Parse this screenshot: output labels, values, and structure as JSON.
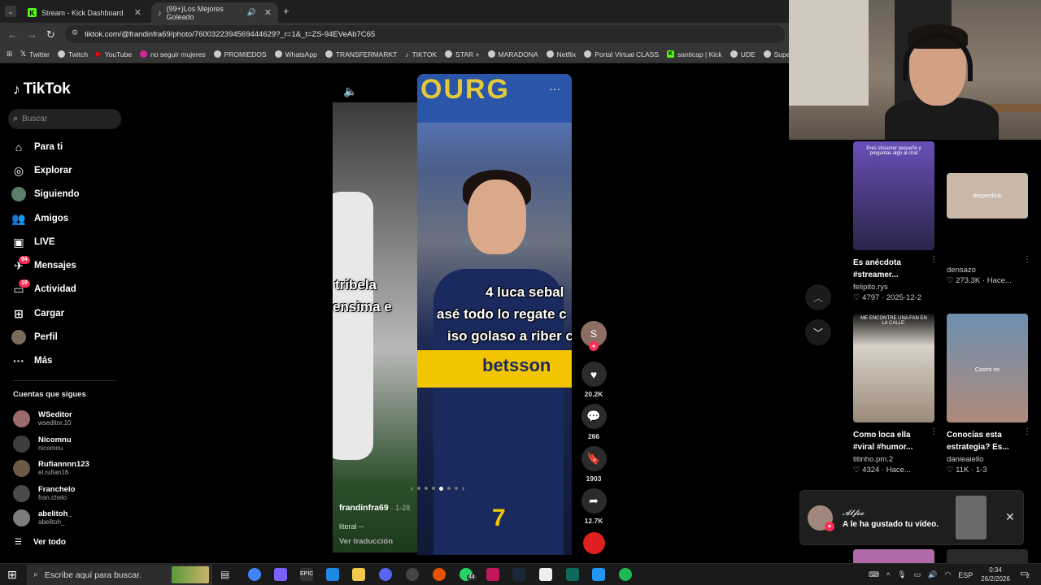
{
  "browser": {
    "tabs": [
      {
        "label": "Stream - Kick Dashboard",
        "active": false
      },
      {
        "label": "(99+)Los Mejores Goleado",
        "active": true
      }
    ],
    "new_tab": "+",
    "url": "tiktok.com/@frandinfra69/photo/7600322394569444629?_r=1&_t=ZS-94EVeAb7C65",
    "bookmarks": [
      "Twitter",
      "Twitch",
      "YouTube",
      "no seguir mujeres",
      "PROMIEDOS",
      "WhatsApp",
      "TRANSFERMARKT",
      "TIKTOK",
      "STAR +",
      "MARADONA",
      "Netflix",
      "Portal Virtual CLASS",
      "santicap | Kick",
      "UDE",
      "Super"
    ]
  },
  "tiktok": {
    "logo": "TikTok",
    "search_placeholder": "Buscar",
    "nav": [
      {
        "label": "Para ti",
        "icon": "home-icon"
      },
      {
        "label": "Explorar",
        "icon": "compass-icon"
      },
      {
        "label": "Siguiendo",
        "icon": "following-avatar-icon"
      },
      {
        "label": "Amigos",
        "icon": "friends-icon"
      },
      {
        "label": "LIVE",
        "icon": "live-icon"
      },
      {
        "label": "Mensajes",
        "icon": "messages-icon",
        "badge": "94"
      },
      {
        "label": "Actividad",
        "icon": "activity-icon",
        "badge": "19"
      },
      {
        "label": "Cargar",
        "icon": "upload-icon"
      },
      {
        "label": "Perfil",
        "icon": "profile-icon"
      },
      {
        "label": "Más",
        "icon": "more-icon"
      }
    ],
    "following_title": "Cuentas que sigues",
    "following": [
      {
        "name": "WSeditor",
        "handle": "wseditor.10"
      },
      {
        "name": "Nicomnu",
        "handle": "nicomnu"
      },
      {
        "name": "Rufiannnn123",
        "handle": "el.rufian16"
      },
      {
        "name": "Franchelo",
        "handle": "fran.chelo"
      },
      {
        "name": "abelitoh_",
        "handle": "abelitoh_"
      }
    ],
    "see_all": "Ver todo"
  },
  "post": {
    "left_caption_1": "tribela",
    "left_caption_2": "ensima e",
    "caption_1": "4 luca sebal",
    "caption_2": "asé todo lo regate c",
    "caption_3": "iso golaso a riber c",
    "sponsor": "betsson",
    "banner": "OURG",
    "shirt_number": "7",
    "username": "frandinfra69",
    "date": "· 1-28",
    "description": "literal --",
    "translate": "Ver traducción",
    "creator_initial": "S",
    "likes": "20.2K",
    "comments": "266",
    "saves": "1903",
    "shares": "12.7K",
    "slide_index": 4,
    "slide_count": 6
  },
  "grid": [
    {
      "overlay": "Eres streamer pequeño y preguntas algo al chat",
      "title_1": "Es anécdota",
      "title_2": "#streamer...",
      "user": "felipito.rys",
      "likes": "4797",
      "meta": "2025-12-2",
      "color": "#7b5cc9"
    },
    {
      "overlay": "desperdicio",
      "title_1": "",
      "title_2": "",
      "user": "densazo",
      "likes": "273.3K",
      "meta": "Hace...",
      "color": "#c9b8a8"
    },
    {
      "overlay": "ME ENCONTRE UNA FAN EN LA CALLE:",
      "title_1": "Como loca ella",
      "title_2": "#viral #humor...",
      "user": "titinho.pm.2",
      "likes": "4324",
      "meta": "Hace...",
      "color": "#d8d2c8"
    },
    {
      "overlay": "Castro no",
      "title_1": "Conocías esta",
      "title_2": "estrategia? Es...",
      "user": "danieaiello",
      "likes": "11K",
      "meta": "1-3",
      "color": "#6c8fb0"
    }
  ],
  "notification": {
    "user": "𝓐𝓵𝓯𝓸𝓸",
    "text": "A le ha gustado tu vídeo.",
    "close": "✕"
  },
  "taskbar": {
    "search_placeholder": "Escribe aquí para buscar.",
    "whatsapp_badge": "44",
    "language": "ESP",
    "time": "0:34",
    "date": "26/2/2026",
    "notif_count": "2"
  }
}
